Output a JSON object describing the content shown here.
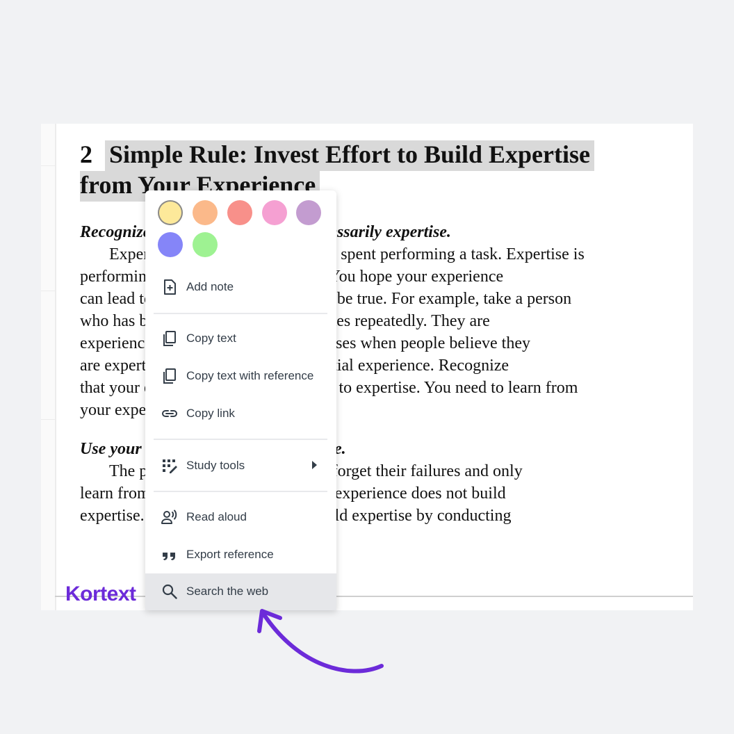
{
  "document": {
    "heading_number": "2",
    "heading_line1": "Simple Rule: Invest Effort to Build Expertise",
    "heading_line2": "from Your Experience",
    "section1_head": "Recognize that experience is not necessarily expertise.",
    "section1_lines": [
      "Experience is the number of years spent performing a task. Expertise is",
      "performing a task at a superior level. You hope your experience",
      "can lead to expertise, but this may not be true. For example, take a person",
      "who has been making the same mistakes repeatedly. They are",
      "experienced, not experts. The issue arises when people believe they",
      "are experts because they have substantial experience. Recognize",
      "that your experience may not have led to expertise. You need to learn from",
      "your experience to build expertise."
    ],
    "section2_head": "Use your experience to build expertise.",
    "section2_lines": [
      "The problem is that people try to forget their failures and only",
      "learn from successes. Therefore, their experience does not build",
      "expertise. Use your experiences to build expertise by conducting"
    ]
  },
  "logo_text": "Kortext",
  "context_menu": {
    "highlight_colors": [
      "#fde99a",
      "#fbb98a",
      "#f8908a",
      "#f5a0d2",
      "#c39cd0",
      "#8585f8",
      "#9ef292"
    ],
    "items": [
      {
        "label": "Add note",
        "icon": "add-note-icon"
      },
      {
        "label": "Copy text",
        "icon": "copy-icon"
      },
      {
        "label": "Copy text with reference",
        "icon": "copy-icon"
      },
      {
        "label": "Copy link",
        "icon": "link-icon"
      },
      {
        "label": "Study tools",
        "icon": "study-tools-icon"
      },
      {
        "label": "Read aloud",
        "icon": "read-aloud-icon"
      },
      {
        "label": "Export reference",
        "icon": "quote-icon"
      },
      {
        "label": "Search the web",
        "icon": "search-icon"
      }
    ]
  },
  "colors": {
    "accent": "#6c2bd9",
    "highlight": "#d9d9d9",
    "menu_active": "#e6e7ea"
  }
}
